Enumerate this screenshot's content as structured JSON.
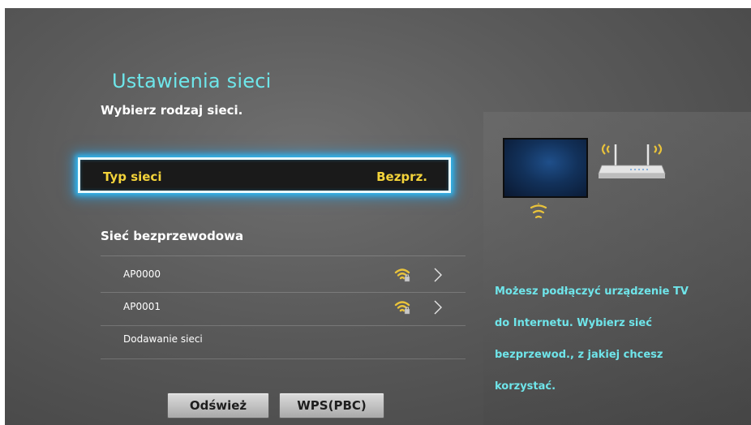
{
  "header": {
    "title": "Ustawienia sieci",
    "subtitle": "Wybierz rodzaj sieci."
  },
  "network_type": {
    "label": "Typ sieci",
    "value": "Bezprz."
  },
  "wireless_section": {
    "header": "Sieć bezprzewodowa",
    "networks": [
      {
        "name": "AP0000",
        "signal_icon": "wifi-signal-icon",
        "arrow_icon": "chevron-right-icon"
      },
      {
        "name": "AP0001",
        "signal_icon": "wifi-signal-icon",
        "arrow_icon": "chevron-right-icon"
      }
    ],
    "add_network_label": "Dodawanie sieci"
  },
  "buttons": {
    "refresh_label": "Odśwież",
    "wps_label": "WPS(PBC)"
  },
  "help": {
    "text": "Możesz podłączyć urządzenie TV do Internetu. Wybierz sieć bezprzewod., z jakiej chcesz korzystać."
  },
  "colors": {
    "title": "#6ee6ea",
    "focus_text": "#f3d33a",
    "focus_glow": "#2fb7f0",
    "help_text": "#6fe5ea",
    "signal": "#e9c33b"
  }
}
